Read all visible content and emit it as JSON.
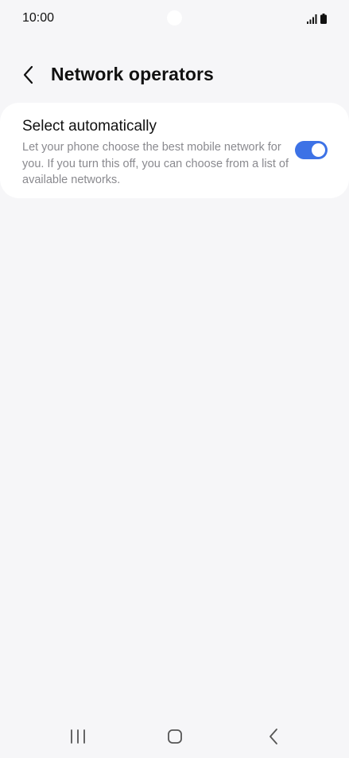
{
  "status_bar": {
    "time": "10:00"
  },
  "header": {
    "title": "Network operators"
  },
  "setting": {
    "title": "Select automatically",
    "description": "Let your phone choose the best mobile network for you. If you turn this off, you can choose from a list of available networks.",
    "enabled": true
  },
  "colors": {
    "accent": "#3d72e6",
    "background": "#f6f6f8",
    "card": "#ffffff",
    "secondary_text": "#8a8a8f"
  }
}
